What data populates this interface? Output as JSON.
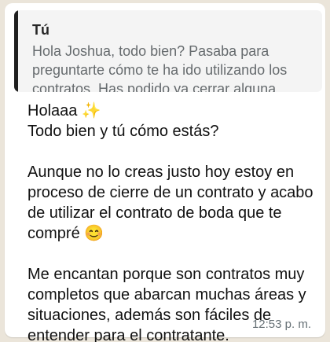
{
  "reply_quote": {
    "author": "Tú",
    "text": "Hola Joshua, todo bien? Pasaba para preguntarte cómo te ha ido utilizando los contratos. Has podido ya cerrar alguna sesió..."
  },
  "message": {
    "text": "Holaaa ✨\nTodo bien y tú cómo estás?\n\nAunque no lo creas justo hoy estoy en proceso de cierre de un contrato y acabo de utilizar el contrato de boda que te compré 😊\n\nMe encantan porque son contratos muy completos que abarcan muchas áreas y situaciones, además son fáciles de entender para el contratante.",
    "timestamp": "12:53 p. m."
  }
}
